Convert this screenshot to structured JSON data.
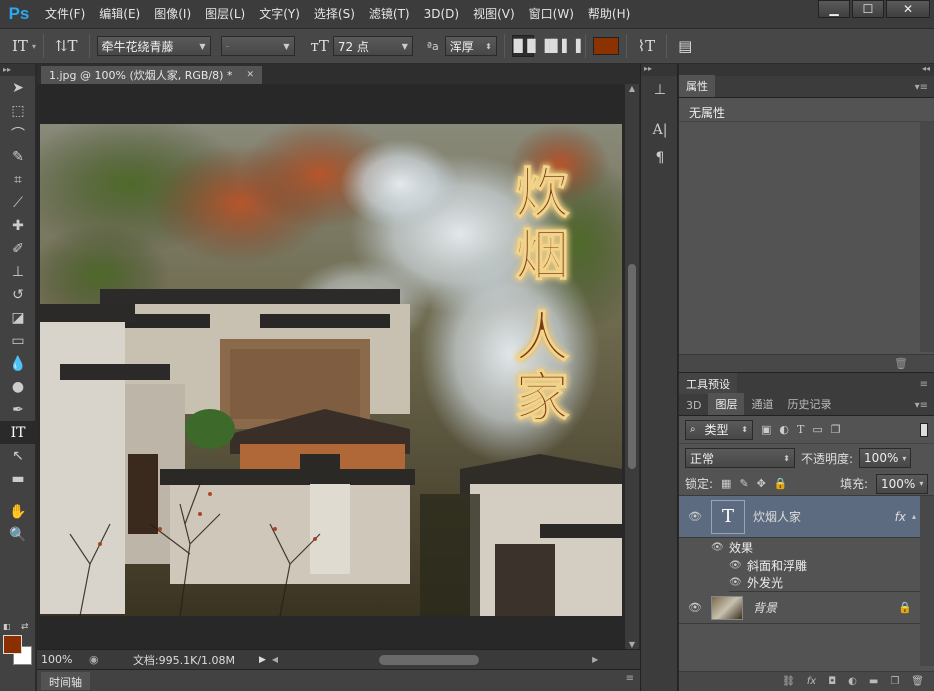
{
  "app": {
    "logo": "Ps"
  },
  "menu": [
    "文件(F)",
    "编辑(E)",
    "图像(I)",
    "图层(L)",
    "文字(Y)",
    "选择(S)",
    "滤镜(T)",
    "3D(D)",
    "视图(V)",
    "窗口(W)",
    "帮助(H)"
  ],
  "window_controls": {
    "minimize": "▁",
    "maximize": "☐",
    "close": "✕"
  },
  "options": {
    "font_family": "牵牛花绕青藤",
    "font_style": "-",
    "font_size": "72 点",
    "aa_label": "ªa",
    "antialias": "浑厚",
    "color": "#8a3200"
  },
  "document": {
    "tab_title": "1.jpg @ 100% (炊烟人家, RGB/8) *",
    "tab_close": "✕",
    "artwork_text": [
      "炊",
      "烟",
      "人",
      "家"
    ]
  },
  "status": {
    "zoom": "100%",
    "doc_info": "文档:995.1K/1.08M"
  },
  "timeline": {
    "tab": "时间轴"
  },
  "properties_panel": {
    "tab": "属性",
    "content": "无属性"
  },
  "tool_presets_panel": {
    "tab": "工具预设"
  },
  "layers_panel": {
    "tabs": [
      "3D",
      "图层",
      "通道",
      "历史记录"
    ],
    "active_tab": "图层",
    "filter_kind": "类型",
    "blend_mode": "正常",
    "opacity_label": "不透明度:",
    "opacity": "100%",
    "lock_label": "锁定:",
    "fill_label": "填充:",
    "fill": "100%",
    "layers": [
      {
        "name": "炊烟人家",
        "type": "text",
        "fx": "fx",
        "effects_label": "效果",
        "effects": [
          "斜面和浮雕",
          "外发光"
        ]
      },
      {
        "name": "背景",
        "type": "image",
        "locked": true
      }
    ]
  },
  "colors": {
    "accent": "#2ca8f0",
    "foreground": "#8a3000",
    "background": "#ffffff",
    "layer_selected": "#5d6b80"
  }
}
